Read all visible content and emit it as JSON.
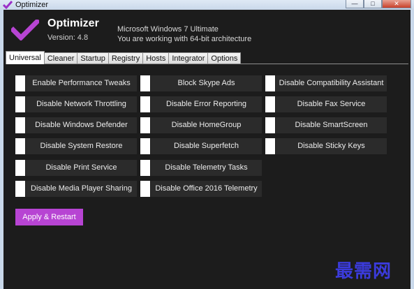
{
  "window": {
    "title": "Optimizer",
    "ghost_title": "",
    "controls": {
      "minimize": "—",
      "maximize": "□",
      "close": "✕"
    }
  },
  "header": {
    "app_name": "Optimizer",
    "version": "Version: 4.8",
    "os_info": "Microsoft Windows 7 Ultimate",
    "arch_info": "You are working with 64-bit architecture",
    "logo_icon": "checkmark-icon",
    "accent_color": "#b744d3"
  },
  "tabs": [
    {
      "label": "Universal",
      "active": true
    },
    {
      "label": "Cleaner",
      "active": false
    },
    {
      "label": "Startup",
      "active": false
    },
    {
      "label": "Registry",
      "active": false
    },
    {
      "label": "Hosts",
      "active": false
    },
    {
      "label": "Integrator",
      "active": false
    },
    {
      "label": "Options",
      "active": false
    }
  ],
  "options": {
    "col1": [
      "Enable Performance Tweaks",
      "Disable Network Throttling",
      "Disable Windows Defender",
      "Disable System Restore",
      "Disable Print Service",
      "Disable Media Player Sharing"
    ],
    "col2": [
      "Block Skype Ads",
      "Disable Error Reporting",
      "Disable HomeGroup",
      "Disable Superfetch",
      "Disable Telemetry Tasks",
      "Disable Office 2016 Telemetry"
    ],
    "col3": [
      "Disable Compatibility Assistant",
      "Disable Fax Service",
      "Disable SmartScreen",
      "Disable Sticky Keys"
    ]
  },
  "actions": {
    "apply_label": "Apply & Restart"
  },
  "watermark": "最需网"
}
